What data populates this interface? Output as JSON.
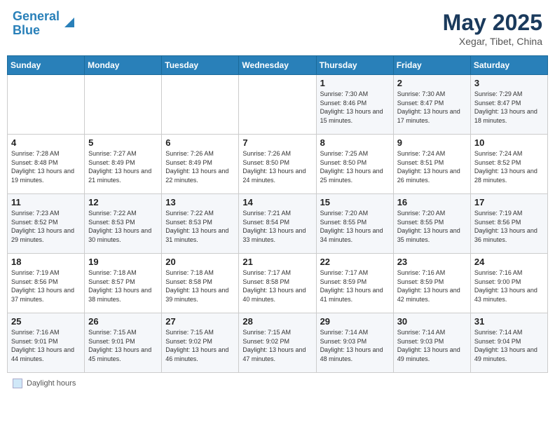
{
  "header": {
    "logo_line1": "General",
    "logo_line2": "Blue",
    "month": "May 2025",
    "location": "Xegar, Tibet, China"
  },
  "days_of_week": [
    "Sunday",
    "Monday",
    "Tuesday",
    "Wednesday",
    "Thursday",
    "Friday",
    "Saturday"
  ],
  "weeks": [
    [
      {
        "num": "",
        "info": ""
      },
      {
        "num": "",
        "info": ""
      },
      {
        "num": "",
        "info": ""
      },
      {
        "num": "",
        "info": ""
      },
      {
        "num": "1",
        "info": "Sunrise: 7:30 AM\nSunset: 8:46 PM\nDaylight: 13 hours and 15 minutes."
      },
      {
        "num": "2",
        "info": "Sunrise: 7:30 AM\nSunset: 8:47 PM\nDaylight: 13 hours and 17 minutes."
      },
      {
        "num": "3",
        "info": "Sunrise: 7:29 AM\nSunset: 8:47 PM\nDaylight: 13 hours and 18 minutes."
      }
    ],
    [
      {
        "num": "4",
        "info": "Sunrise: 7:28 AM\nSunset: 8:48 PM\nDaylight: 13 hours and 19 minutes."
      },
      {
        "num": "5",
        "info": "Sunrise: 7:27 AM\nSunset: 8:49 PM\nDaylight: 13 hours and 21 minutes."
      },
      {
        "num": "6",
        "info": "Sunrise: 7:26 AM\nSunset: 8:49 PM\nDaylight: 13 hours and 22 minutes."
      },
      {
        "num": "7",
        "info": "Sunrise: 7:26 AM\nSunset: 8:50 PM\nDaylight: 13 hours and 24 minutes."
      },
      {
        "num": "8",
        "info": "Sunrise: 7:25 AM\nSunset: 8:50 PM\nDaylight: 13 hours and 25 minutes."
      },
      {
        "num": "9",
        "info": "Sunrise: 7:24 AM\nSunset: 8:51 PM\nDaylight: 13 hours and 26 minutes."
      },
      {
        "num": "10",
        "info": "Sunrise: 7:24 AM\nSunset: 8:52 PM\nDaylight: 13 hours and 28 minutes."
      }
    ],
    [
      {
        "num": "11",
        "info": "Sunrise: 7:23 AM\nSunset: 8:52 PM\nDaylight: 13 hours and 29 minutes."
      },
      {
        "num": "12",
        "info": "Sunrise: 7:22 AM\nSunset: 8:53 PM\nDaylight: 13 hours and 30 minutes."
      },
      {
        "num": "13",
        "info": "Sunrise: 7:22 AM\nSunset: 8:53 PM\nDaylight: 13 hours and 31 minutes."
      },
      {
        "num": "14",
        "info": "Sunrise: 7:21 AM\nSunset: 8:54 PM\nDaylight: 13 hours and 33 minutes."
      },
      {
        "num": "15",
        "info": "Sunrise: 7:20 AM\nSunset: 8:55 PM\nDaylight: 13 hours and 34 minutes."
      },
      {
        "num": "16",
        "info": "Sunrise: 7:20 AM\nSunset: 8:55 PM\nDaylight: 13 hours and 35 minutes."
      },
      {
        "num": "17",
        "info": "Sunrise: 7:19 AM\nSunset: 8:56 PM\nDaylight: 13 hours and 36 minutes."
      }
    ],
    [
      {
        "num": "18",
        "info": "Sunrise: 7:19 AM\nSunset: 8:56 PM\nDaylight: 13 hours and 37 minutes."
      },
      {
        "num": "19",
        "info": "Sunrise: 7:18 AM\nSunset: 8:57 PM\nDaylight: 13 hours and 38 minutes."
      },
      {
        "num": "20",
        "info": "Sunrise: 7:18 AM\nSunset: 8:58 PM\nDaylight: 13 hours and 39 minutes."
      },
      {
        "num": "21",
        "info": "Sunrise: 7:17 AM\nSunset: 8:58 PM\nDaylight: 13 hours and 40 minutes."
      },
      {
        "num": "22",
        "info": "Sunrise: 7:17 AM\nSunset: 8:59 PM\nDaylight: 13 hours and 41 minutes."
      },
      {
        "num": "23",
        "info": "Sunrise: 7:16 AM\nSunset: 8:59 PM\nDaylight: 13 hours and 42 minutes."
      },
      {
        "num": "24",
        "info": "Sunrise: 7:16 AM\nSunset: 9:00 PM\nDaylight: 13 hours and 43 minutes."
      }
    ],
    [
      {
        "num": "25",
        "info": "Sunrise: 7:16 AM\nSunset: 9:01 PM\nDaylight: 13 hours and 44 minutes."
      },
      {
        "num": "26",
        "info": "Sunrise: 7:15 AM\nSunset: 9:01 PM\nDaylight: 13 hours and 45 minutes."
      },
      {
        "num": "27",
        "info": "Sunrise: 7:15 AM\nSunset: 9:02 PM\nDaylight: 13 hours and 46 minutes."
      },
      {
        "num": "28",
        "info": "Sunrise: 7:15 AM\nSunset: 9:02 PM\nDaylight: 13 hours and 47 minutes."
      },
      {
        "num": "29",
        "info": "Sunrise: 7:14 AM\nSunset: 9:03 PM\nDaylight: 13 hours and 48 minutes."
      },
      {
        "num": "30",
        "info": "Sunrise: 7:14 AM\nSunset: 9:03 PM\nDaylight: 13 hours and 49 minutes."
      },
      {
        "num": "31",
        "info": "Sunrise: 7:14 AM\nSunset: 9:04 PM\nDaylight: 13 hours and 49 minutes."
      }
    ]
  ],
  "footer": {
    "legend_label": "Daylight hours"
  }
}
